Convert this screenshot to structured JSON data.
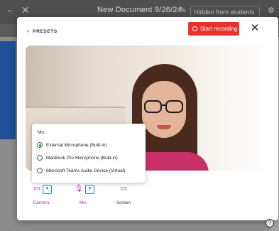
{
  "app": {
    "title": "New Document 9/26/24",
    "status": "Hidden from students",
    "close_icon": "close-icon",
    "back_icon": "arrow-left-icon",
    "lock_icon": "lock-icon",
    "settings_icon": "gear-icon"
  },
  "modal": {
    "back_label": "PRESETS",
    "record_label": "Start recording",
    "close_label": "✕",
    "record_color": "#e8322b"
  },
  "mic_menu": {
    "title": "Mic",
    "options": [
      {
        "label": "External Microphone (Built-in)",
        "selected": true
      },
      {
        "label": "MacBook Pro Microphone (Built-in)",
        "selected": false
      },
      {
        "label": "Microsoft Teams Audio Device (Virtual)",
        "selected": false
      }
    ]
  },
  "sources": {
    "camera": {
      "label": "Camera",
      "color": "#c026a8"
    },
    "mic": {
      "label": "Mic",
      "color": "#c026a8"
    },
    "screen": {
      "label": "Screen",
      "color": "#333333"
    },
    "caret": "▾"
  },
  "help_label": "?"
}
